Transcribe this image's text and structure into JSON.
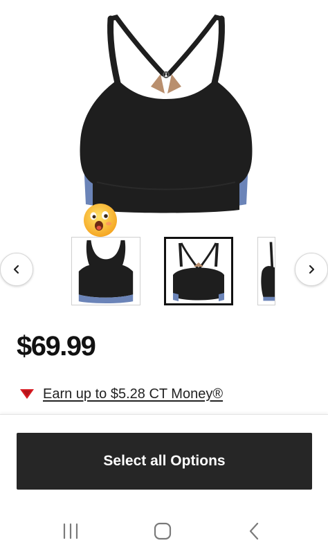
{
  "product": {
    "hero_icon": "sports-bra-product-image",
    "emoji_icon": "surprised-face-emoji-icon"
  },
  "carousel": {
    "prev_icon": "chevron-left-icon",
    "next_icon": "chevron-right-icon",
    "selected_index": 1,
    "thumbnails": [
      "thumb-front-view",
      "thumb-back-view",
      "thumb-side-view"
    ]
  },
  "price": {
    "value": "$69.99"
  },
  "rewards": {
    "icon": "red-triangle-icon",
    "text": "Earn up to $5.28 CT Money®"
  },
  "cta": {
    "label": "Select all Options"
  },
  "system_nav": {
    "recents_icon": "recents-icon",
    "home_icon": "home-icon",
    "back_icon": "back-icon"
  },
  "colors": {
    "cta_bg": "#262626",
    "garment": "#1e1e1e",
    "accent_blue": "#6b84b8",
    "accent_tan": "#b98f6e",
    "triangle_red": "#d71a21"
  }
}
